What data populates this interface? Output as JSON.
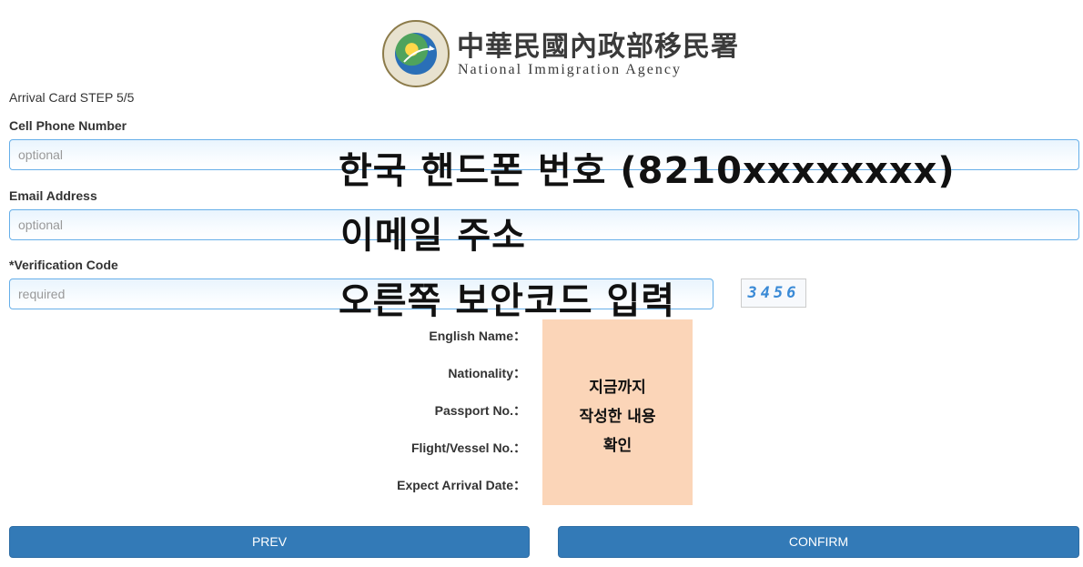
{
  "header": {
    "agency_name_zh": "中華民國內政部移民署",
    "agency_name_en": "National Immigration Agency",
    "emblem_icon": "nia-emblem-icon"
  },
  "step_title": "Arrival Card STEP 5/5",
  "form": {
    "phone": {
      "label": "Cell Phone Number",
      "placeholder": "optional",
      "value": ""
    },
    "email": {
      "label": "Email Address",
      "placeholder": "optional",
      "value": ""
    },
    "verification": {
      "label": "*Verification Code",
      "placeholder": "required",
      "value": ""
    },
    "captcha_text": "3456"
  },
  "overlays": {
    "phone_note": "한국 핸드폰 번호 (8210xxxxxxxx)",
    "email_note": "이메일 주소",
    "verification_note": "오른쪽 보안코드 입력",
    "summary_note_line1": "지금까지",
    "summary_note_line2": "작성한 내용",
    "summary_note_line3": "확인"
  },
  "summary": {
    "english_name_label": "English Name：",
    "nationality_label": "Nationality：",
    "passport_label": "Passport No.：",
    "flight_label": "Flight/Vessel No.：",
    "arrival_date_label": "Expect Arrival Date："
  },
  "buttons": {
    "prev": "PREV",
    "confirm": "CONFIRM"
  },
  "colors": {
    "button_bg": "#337ab7",
    "field_border": "#66afe9",
    "summary_highlight": "#fbd5b8"
  }
}
